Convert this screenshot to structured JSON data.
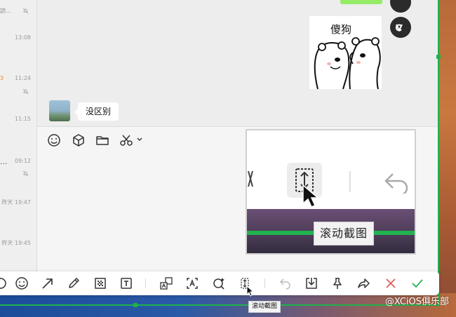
{
  "chat_list": {
    "fragments": [
      "読..."
    ],
    "times": [
      "13:08",
      "11:24",
      "11:15",
      "09:12",
      "昨天 19:47",
      "昨天 19:45"
    ],
    "ellipsis": "...",
    "orange_mark": "3"
  },
  "chat": {
    "incoming_message": "没区别",
    "sticker_caption": "傻狗"
  },
  "input_toolbar": {
    "icons": [
      "smiley-icon",
      "cube-icon",
      "folder-icon",
      "scissors-icon",
      "chevron-down-icon"
    ]
  },
  "magnifier": {
    "tooltip": "滚动截图"
  },
  "screenshot_toolbar": {
    "tooltip": "滚动截图",
    "tools": [
      "circle",
      "emoji",
      "arrow",
      "pen",
      "mosaic",
      "text",
      "translate",
      "ocr",
      "pin-search",
      "scroll-capture",
      "undo",
      "download",
      "pin",
      "share",
      "close",
      "confirm"
    ]
  },
  "watermark": "@XCiOS俱乐部",
  "colors": {
    "selection_green": "#1fb24a",
    "bubble_green": "#95ec69",
    "close_red": "#e25c5c",
    "confirm_green": "#21b250"
  }
}
